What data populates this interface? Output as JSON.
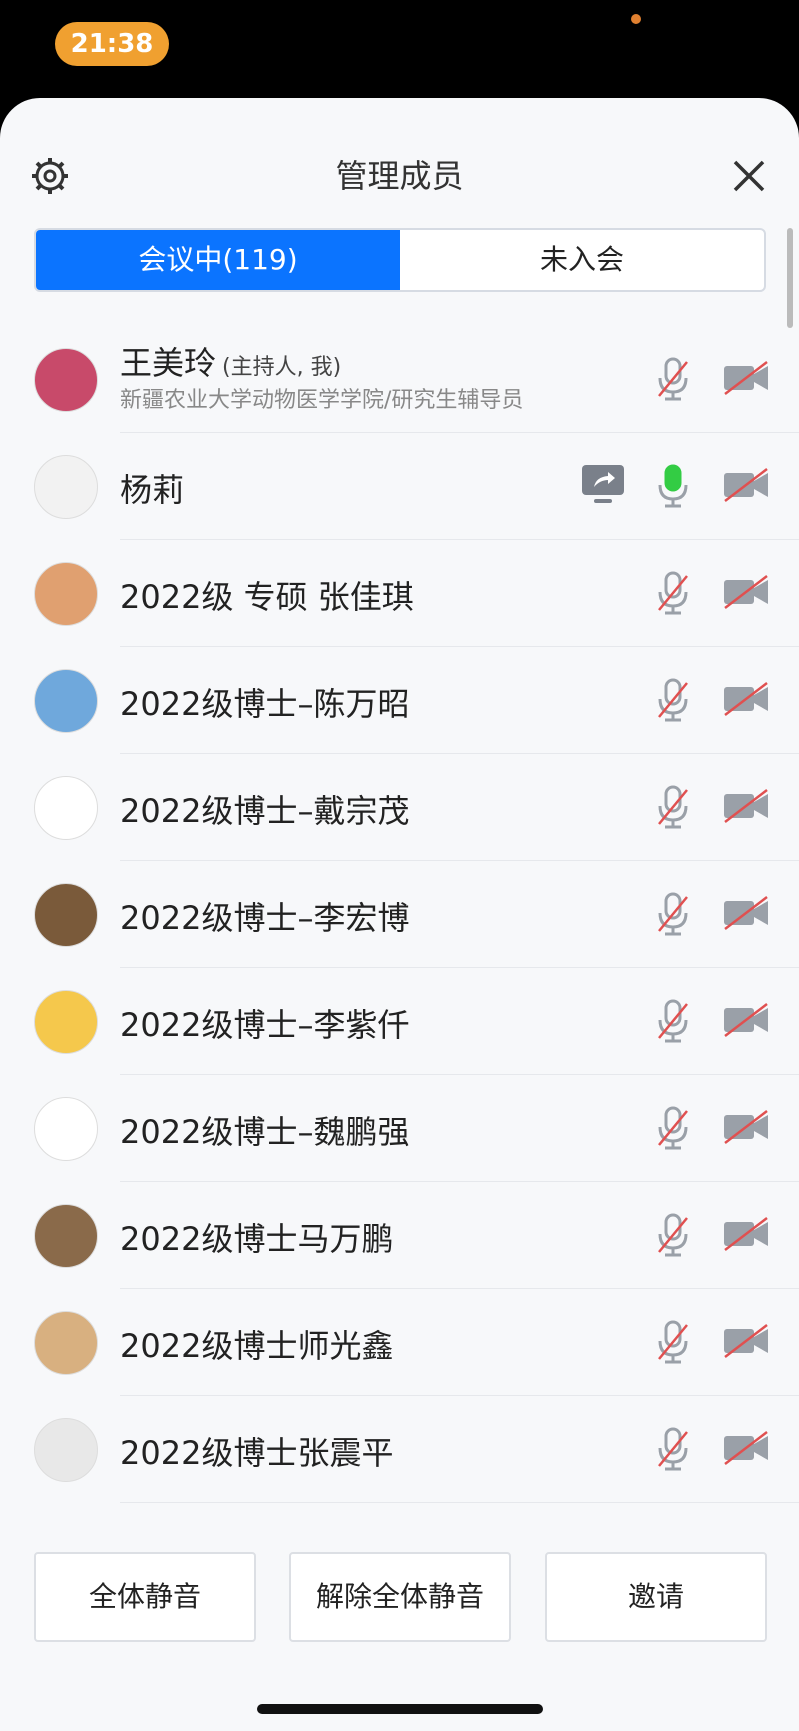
{
  "status_bar": {
    "time": "21:38"
  },
  "header": {
    "title": "管理成员"
  },
  "tabs": [
    {
      "label": "会议中(119)",
      "active": true
    },
    {
      "label": "未入会",
      "active": false
    }
  ],
  "members": [
    {
      "name": "王美玲",
      "tag": "(主持人, 我)",
      "subtitle": "新疆农业大学动物医学学院/研究生辅导员",
      "mic": "muted",
      "camera": "off",
      "avatar_color": "#c84a6a"
    },
    {
      "name": "杨莉",
      "mic": "active",
      "camera": "off",
      "sharing": true,
      "avatar_color": "#f2f2f2"
    },
    {
      "name": "2022级 专硕 张佳琪",
      "mic": "muted",
      "camera": "off",
      "avatar_color": "#e0a070"
    },
    {
      "name": "2022级博士–陈万昭",
      "mic": "muted",
      "camera": "off",
      "avatar_color": "#6fa8dc"
    },
    {
      "name": "2022级博士–戴宗茂",
      "mic": "muted",
      "camera": "off",
      "avatar_color": "#ffffff"
    },
    {
      "name": "2022级博士–李宏博",
      "mic": "muted",
      "camera": "off",
      "avatar_color": "#7a5a3a"
    },
    {
      "name": "2022级博士–李紫仟",
      "mic": "muted",
      "camera": "off",
      "avatar_color": "#f5c84c"
    },
    {
      "name": "2022级博士–魏鹏强",
      "mic": "muted",
      "camera": "off",
      "avatar_color": "#ffffff"
    },
    {
      "name": "2022级博士马万鹏",
      "mic": "muted",
      "camera": "off",
      "avatar_color": "#8a6a4a"
    },
    {
      "name": "2022级博士师光鑫",
      "mic": "muted",
      "camera": "off",
      "avatar_color": "#d8b080"
    },
    {
      "name": "2022级博士张震平",
      "mic": "muted",
      "camera": "off",
      "avatar_color": "#e8e8e8"
    }
  ],
  "footer": {
    "mute_all": "全体静音",
    "unmute_all": "解除全体静音",
    "invite": "邀请"
  },
  "colors": {
    "accent": "#0b74ff",
    "muted_slash": "#e05050",
    "mic_active": "#33cc44",
    "time_pill": "#f0a030"
  }
}
